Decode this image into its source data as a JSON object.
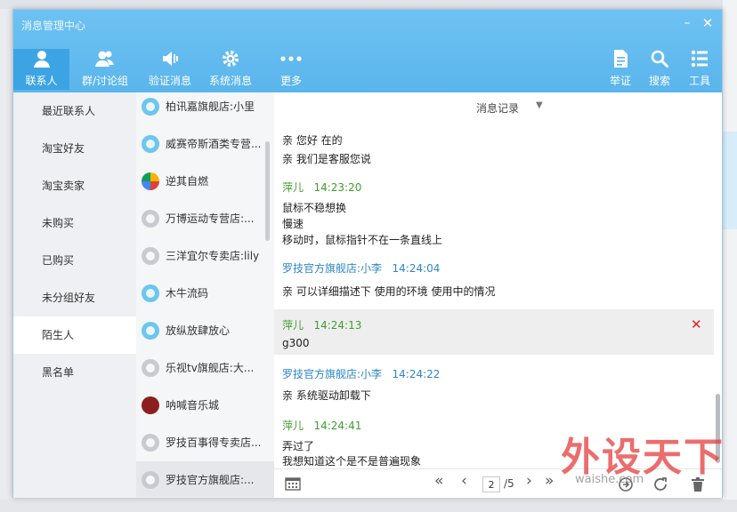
{
  "window": {
    "title": "消息管理中心",
    "minimize": "–",
    "close": "✕"
  },
  "toolbar": {
    "left": [
      {
        "label": "联系人",
        "icon": "person-icon"
      },
      {
        "label": "群/讨论组",
        "icon": "group-icon"
      },
      {
        "label": "验证消息",
        "icon": "speaker-icon"
      },
      {
        "label": "系统消息",
        "icon": "gear-icon"
      },
      {
        "label": "更多",
        "icon": "more-dots-icon"
      }
    ],
    "right": [
      {
        "label": "举证",
        "icon": "document-icon"
      },
      {
        "label": "搜索",
        "icon": "search-icon"
      },
      {
        "label": "工具",
        "icon": "list-icon"
      }
    ]
  },
  "sidebar": {
    "items": [
      "最近联系人",
      "淘宝好友",
      "淘宝卖家",
      "未购买",
      "已购买",
      "未分组好友",
      "陌生人",
      "黑名单"
    ],
    "active_index": 6
  },
  "contacts": [
    "柏讯嘉旗舰店:小里",
    "威赛帝斯酒类专营...",
    "逆其自燃",
    "万博运动专营店:...",
    "三洋宜尔专卖店:lily",
    "木牛流码",
    "放纵放肆放心",
    "乐视tv旗舰店:大...",
    "呐喊音乐城",
    "罗技百事得专卖店...",
    "罗技官方旗舰店:..."
  ],
  "chat": {
    "header_label": "消息记录",
    "header_caret": "▼",
    "messages": [
      {
        "lines": [
          "亲 您好 在的",
          "亲 我们是客服您说"
        ]
      },
      {
        "sender": "萍儿",
        "time": "14:23:20",
        "color": "#3f9e2f",
        "lines": [
          "鼠标不稳想换",
          "慢速",
          "移动时，鼠标指针不在一条直线上"
        ]
      },
      {
        "sender": "罗技官方旗舰店:小李",
        "time": "14:24:04",
        "color": "#2e86c9",
        "lines": [
          "亲 可以详细描述下 使用的环境 使用中的情况"
        ]
      },
      {
        "sender": "萍儿",
        "time": "14:24:13",
        "color": "#3f9e2f",
        "lines": [
          "g300"
        ]
      },
      {
        "sender": "罗技官方旗舰店:小李",
        "time": "14:24:22",
        "color": "#2e86c9",
        "lines": [
          "亲 系统驱动卸载下"
        ]
      },
      {
        "sender": "萍儿",
        "time": "14:24:41",
        "color": "#3f9e2f",
        "lines": [
          "弄过了",
          "我想知道这个是不是普遍现象"
        ]
      }
    ],
    "delete_mark": "✕"
  },
  "footer": {
    "first": "«",
    "prev": "‹",
    "page": "2",
    "total": "/5",
    "next": "›",
    "last": "»"
  },
  "watermark": {
    "text": "外设天下",
    "sub": "waishe.com"
  }
}
